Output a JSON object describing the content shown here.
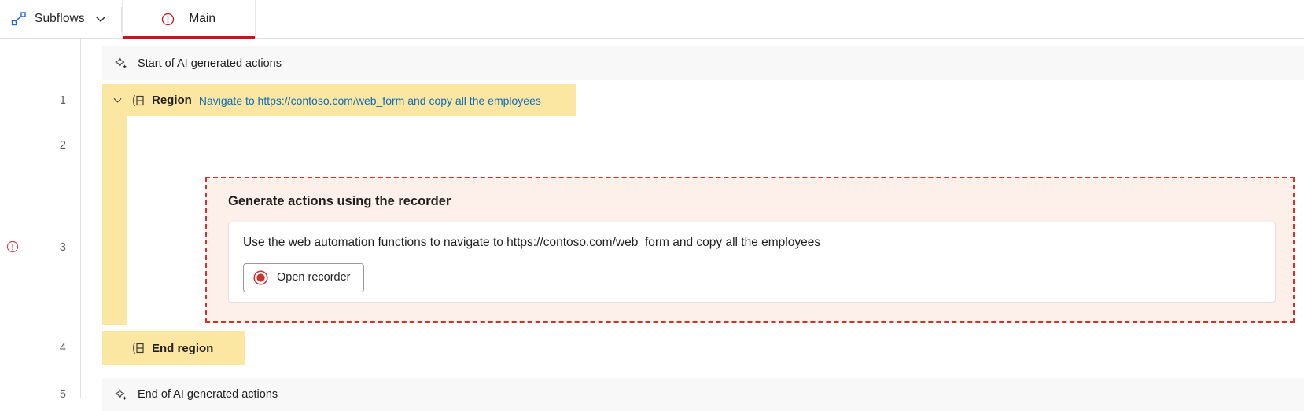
{
  "tabstrip": {
    "subflows": {
      "label": "Subflows",
      "icon": "subflows-icon",
      "chevron": "chevron-down-icon"
    },
    "tabs": [
      {
        "label": "Main",
        "icon": "error-circle-icon",
        "active": true
      }
    ]
  },
  "gutter": {
    "row_numbers": [
      "1",
      "2",
      "3",
      "4",
      "5"
    ],
    "error_marker_row": "3",
    "error_icon": "error-circle-icon"
  },
  "canvas": {
    "rows": [
      {
        "number": "1",
        "type": "ai-marker",
        "icon": "sparkle-icon",
        "label": "Start of AI generated actions"
      },
      {
        "number": "2",
        "type": "region-start",
        "chevron": "chevron-down-icon",
        "icon": "region-icon",
        "title": "Region",
        "description": "Navigate to https://contoso.com/web_form and copy all the employees"
      },
      {
        "number": "3",
        "type": "ai-recorder-panel",
        "title": "Generate actions using the recorder",
        "instruction": "Use the web automation functions to navigate to https://contoso.com/web_form and copy all the employees",
        "button": {
          "label": "Open recorder",
          "icon": "record-circle-icon"
        }
      },
      {
        "number": "4",
        "type": "region-end",
        "icon": "region-icon",
        "title": "End region"
      },
      {
        "number": "5",
        "type": "ai-marker",
        "icon": "sparkle-icon",
        "label": "End of AI generated actions"
      }
    ]
  },
  "colors": {
    "region_yellow": "#fce7a2",
    "ai_panel_fill": "#fdf0ea",
    "ai_panel_border": "#d0332c",
    "error_red": "#c4161c",
    "link_blue": "#0f6cbd",
    "row_grey": "#f8f8f8",
    "accent_blue": "#2266dd"
  }
}
